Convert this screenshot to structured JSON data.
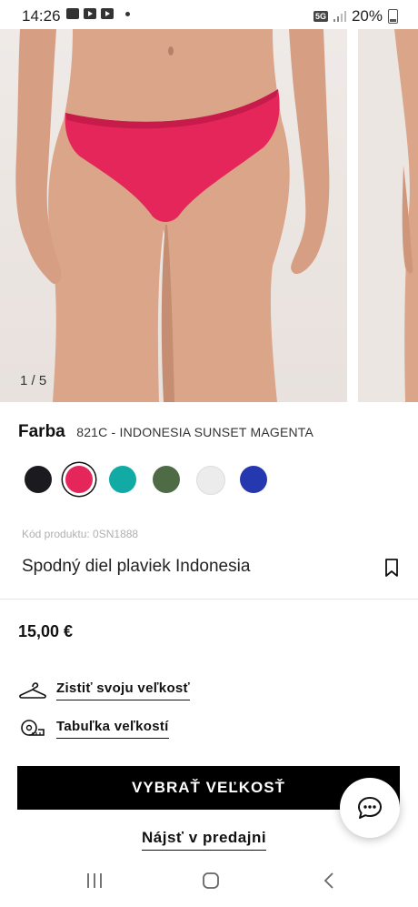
{
  "status_bar": {
    "time": "14:26",
    "network": "5G",
    "battery": "20%",
    "icons": [
      "gallery-icon",
      "youtube-icon",
      "youtube-icon",
      "notification-dot-icon",
      "signal-icon",
      "battery-icon"
    ]
  },
  "gallery": {
    "pager": "1 / 5"
  },
  "product": {
    "color_label": "Farba",
    "color_name": "821C - INDONESIA SUNSET MAGENTA",
    "swatches": [
      {
        "color": "#1b1b1f",
        "selected": false
      },
      {
        "color": "#e5265a",
        "selected": true
      },
      {
        "color": "#12aaa4",
        "selected": false
      },
      {
        "color": "#4e6b45",
        "selected": false
      },
      {
        "color": "#ececec",
        "selected": false
      },
      {
        "color": "#2638b0",
        "selected": false
      }
    ],
    "code": "Kód produktu: 0SN1888",
    "title": "Spodný diel plaviek Indonesia",
    "price": "15,00 €"
  },
  "links": {
    "find_size": "Zistiť svoju veľkosť",
    "size_chart": "Tabuľka veľkostí"
  },
  "actions": {
    "choose_size": "VYBRAŤ VEĽKOSŤ",
    "find_in_store": "Nájsť v predajni"
  },
  "colors": {
    "accent": "#000000",
    "product": "#e5265a"
  }
}
